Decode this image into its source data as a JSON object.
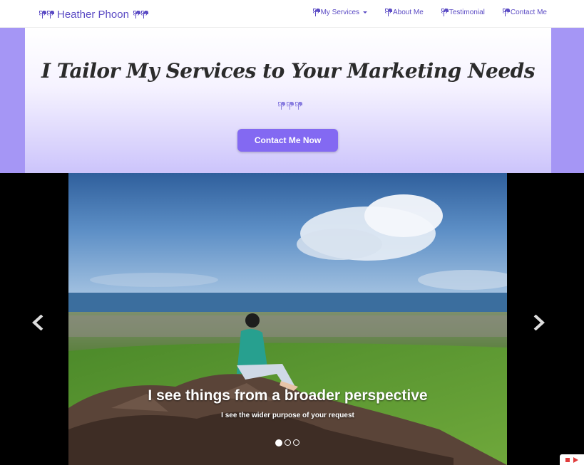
{
  "brand": {
    "name": "Heather Phoon"
  },
  "nav": {
    "items": [
      {
        "label": "My Services",
        "dropdown": true
      },
      {
        "label": "About Me"
      },
      {
        "label": "Testimonial"
      },
      {
        "label": "Contact Me"
      }
    ]
  },
  "hero": {
    "title": "I Tailor My Services to Your Marketing Needs",
    "cta_label": "Contact Me Now"
  },
  "carousel": {
    "caption_title": "I see things from a broader perspective",
    "caption_text": "I see the wider purpose of your request",
    "slide_count": 3,
    "active_slide": 1
  },
  "colors": {
    "brand": "#5b4bc4",
    "accent": "#8369f2",
    "band": "#a596f5",
    "widget": "#e03c3c"
  },
  "icons": [
    "sprout-icon",
    "chevron-left-icon",
    "chevron-right-icon",
    "caret-down-icon",
    "stop-icon",
    "play-icon"
  ]
}
